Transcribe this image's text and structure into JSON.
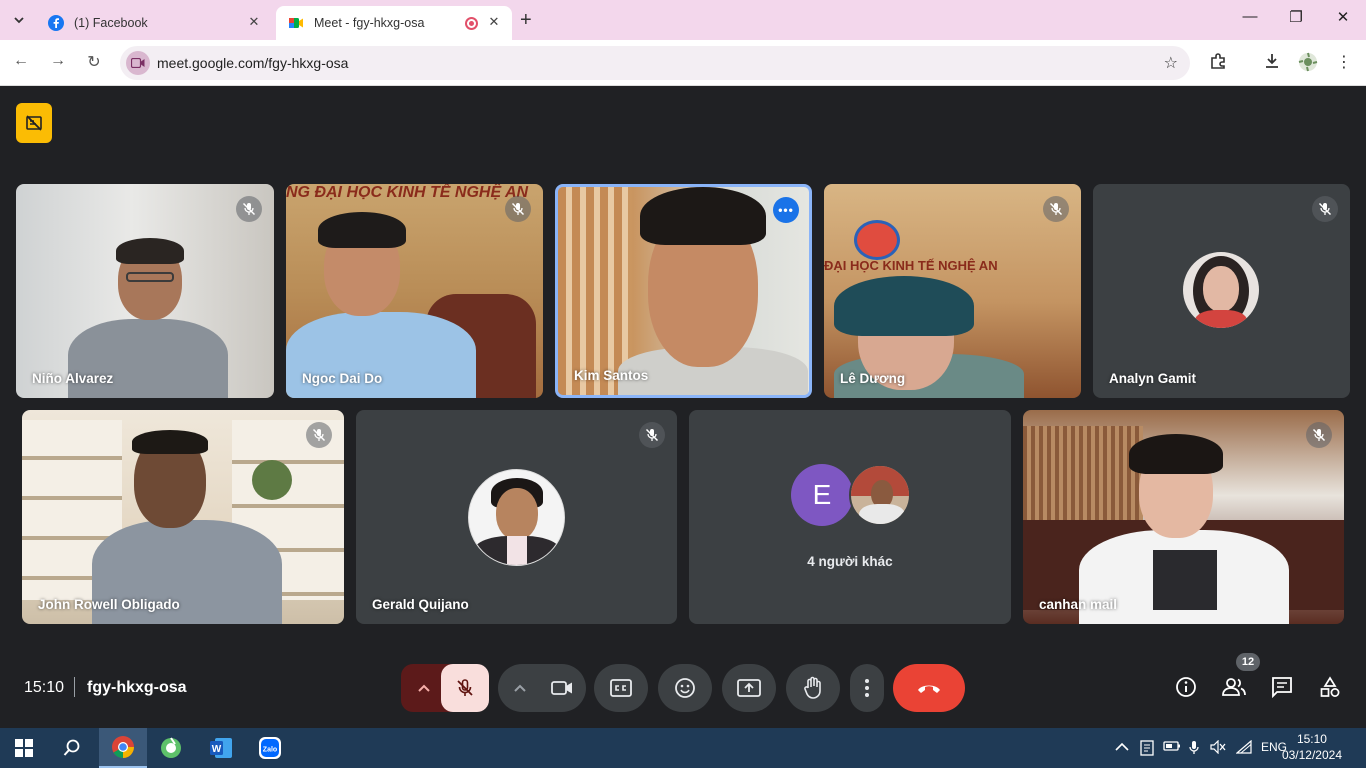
{
  "browser": {
    "tabs": [
      {
        "title": "(1) Facebook",
        "favicon": "facebook-icon"
      },
      {
        "title": "Meet - fgy-hkxg-osa",
        "favicon": "google-meet-icon",
        "recording": true
      }
    ],
    "url": "meet.google.com/fgy-hkxg-osa"
  },
  "participants": [
    {
      "name": "Niño Alvarez",
      "muted": true
    },
    {
      "name": "Ngoc Dai Do",
      "muted": true,
      "background_text": "NG ĐẠI HỌC KINH TẾ NGHỆ AN"
    },
    {
      "name": "Kim Santos",
      "speaking": true
    },
    {
      "name": "Lê Dương",
      "muted": true,
      "background_text": "ĐẠI HỌC KINH TẾ NGHỆ AN"
    },
    {
      "name": "Analyn Gamit",
      "muted": true
    },
    {
      "name": "John Rowell Obligado",
      "muted": true
    },
    {
      "name": "Gerald Quijano",
      "muted": true
    },
    {
      "name": "",
      "others_label": "4 người khác",
      "avatar_letter": "E"
    },
    {
      "name": "canhan mail",
      "muted": true
    }
  ],
  "meeting": {
    "time": "15:10",
    "code": "fgy-hkxg-osa",
    "people_count": "12"
  },
  "taskbar": {
    "language": "ENG",
    "time": "15:10",
    "date": "03/12/2024"
  },
  "colors": {
    "end_call": "#ea4335",
    "mic_muted_bg": "#f9dedc",
    "active_border": "#8ab4f8",
    "host_badge": "#fbbc04",
    "avatar_e": "#7e57c2"
  }
}
